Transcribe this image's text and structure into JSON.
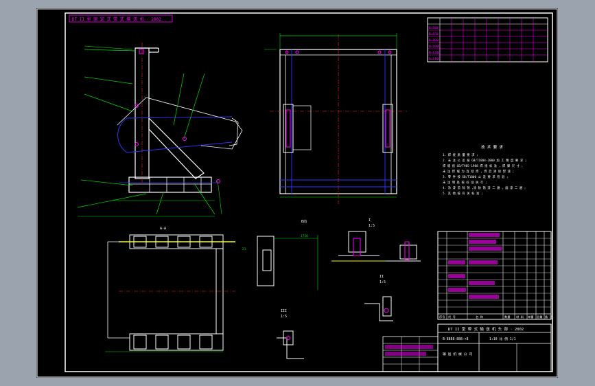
{
  "drawing": {
    "title_banner": "DT II 型 固 定 式 带 式 输 送 机 · 2002",
    "title_block_main": "DT II 型  带 式 输 送 机 头 部 · 2002",
    "drawing_number": "B-8888-888-×8",
    "scale_text": "1:10 比 例 1/1",
    "company_text": "输 送 机 械 公 司",
    "notes_title": "技 术 要 求",
    "notes": [
      "1. 焊 接 质 量 要 求 ;",
      "2. 未 注 公 差 按 GB/T1804-2000 加 工 精 度 要 求 ;",
      "   焊 缝 按 GB/T985-1988 焊 接 标 准 , 焊 脚 尺 寸 ;",
      "   未 注 焊 缝 为 连 续 焊 , 焊 后 清 除 焊 渣 ;",
      "3. 零 件 按 GB/T1800 公 差 要 求 检 验 ;",
      "   未 注 明 处 按 标 准 执 行 ;",
      "4. 涂 漆 前 除 锈 ,涂 防 锈 漆 二 遍 , 面 漆 二 遍 ;",
      "5. 其 他 按 有 关 标 准 ;"
    ],
    "section_labels": {
      "aa": "A-A",
      "b": "B向",
      "i": "I",
      "i_scale": "1:5",
      "ii": "II",
      "ii_scale": "1:5",
      "iii": "III",
      "iii_scale": "1:5"
    },
    "dimensions": {
      "d1": "1730",
      "d2": "980",
      "d3": "1780",
      "d4": "860",
      "d5": "21",
      "d6": "5"
    },
    "parts_header": [
      "序号",
      "代 号",
      "名 称",
      "数量",
      "材 料",
      "单重",
      "总重",
      "备 注"
    ],
    "top_table_rows": [
      "B=500",
      "B=650",
      "B=800",
      "B=1000",
      "B=1200",
      "B=1400"
    ]
  },
  "colors": {
    "background": "#000000",
    "frame": "#ffffff",
    "green": "#00e000",
    "magenta": "#ff00ff",
    "blue": "#3333ff",
    "yellow": "#ffff00",
    "cyan": "#00ffff",
    "red": "#ff2020"
  }
}
